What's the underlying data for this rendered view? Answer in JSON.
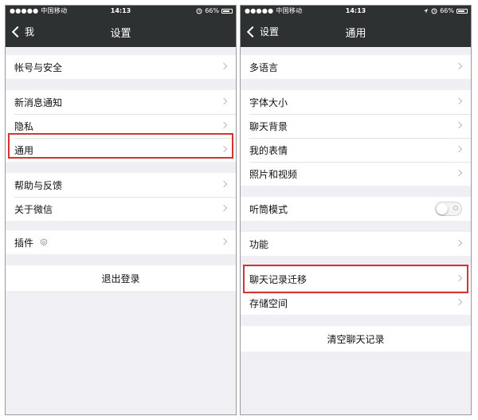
{
  "left": {
    "status": {
      "carrier": "●●●●● 中国移动",
      "time": "14:13",
      "battery": "66%"
    },
    "nav": {
      "back": "我",
      "title": "设置"
    },
    "account": "帐号与安全",
    "notify": "新消息通知",
    "privacy": "隐私",
    "general": "通用",
    "help": "帮助与反馈",
    "about": "关于微信",
    "plugins": "插件",
    "logout": "退出登录"
  },
  "right": {
    "status": {
      "carrier": "●●●●● 中国移动",
      "time": "14:13",
      "battery": "66%"
    },
    "nav": {
      "back": "设置",
      "title": "通用"
    },
    "language": "多语言",
    "font_size": "字体大小",
    "chat_background": "聊天背景",
    "my_stickers": "我的表情",
    "photos_videos": "照片和视频",
    "earpiece_mode": "听筒模式",
    "earpiece_on": false,
    "features": "功能",
    "chat_migration": "聊天记录迁移",
    "storage": "存储空间",
    "clear_history": "清空聊天记录"
  },
  "highlight_color": "#d33535"
}
